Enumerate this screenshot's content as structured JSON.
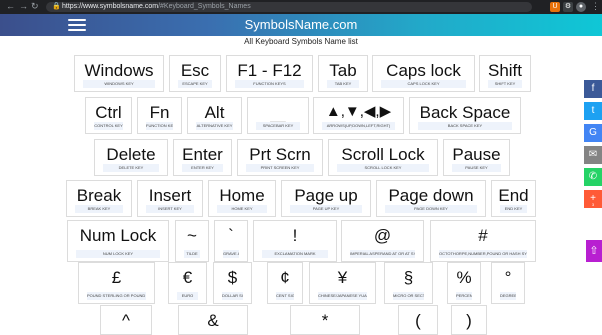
{
  "browser": {
    "url_host": "https://www.symbolsname.com",
    "url_rest": "/#Keyboard_Symbols_Names"
  },
  "site": {
    "title": "SymbolsName.com",
    "subtitle": "All Keyboard Symbols Name list"
  },
  "keys": [
    {
      "sym": "Windows",
      "cap": "WINDOWS KEY"
    },
    {
      "sym": "Esc",
      "cap": "ESCAPE KEY"
    },
    {
      "sym": "F1 - F12",
      "cap": "FUNCTION KEYS"
    },
    {
      "sym": "Tab",
      "cap": "TAB KEY"
    },
    {
      "sym": "Caps lock",
      "cap": "CAPS LOCK KEY"
    },
    {
      "sym": "Shift",
      "cap": "SHIFT KEY"
    },
    {
      "sym": "Ctrl",
      "cap": "CONTROL KEY"
    },
    {
      "sym": "Fn",
      "cap": "FUNCTION KEY"
    },
    {
      "sym": "Alt",
      "cap": "ALTERNATIVE KEY"
    },
    {
      "sym": "▁",
      "cap": "SPACEBAR KEY"
    },
    {
      "sym": "▲,▼,◀,▶",
      "cap": "ARROWS(UP,DOWN,LEFT,RIGHT)"
    },
    {
      "sym": "Back Space",
      "cap": "BACK SPACE KEY"
    },
    {
      "sym": "Delete",
      "cap": "DELETE KEY"
    },
    {
      "sym": "Enter",
      "cap": "ENTER KEY"
    },
    {
      "sym": "Prt Scrn",
      "cap": "PRINT SCREEN KEY"
    },
    {
      "sym": "Scroll Lock",
      "cap": "SCROLL LOCK KEY"
    },
    {
      "sym": "Pause",
      "cap": "PAUSE KEY"
    },
    {
      "sym": "Break",
      "cap": "BREAK KEY"
    },
    {
      "sym": "Insert",
      "cap": "INSERT KEY"
    },
    {
      "sym": "Home",
      "cap": "HOME KEY"
    },
    {
      "sym": "Page up",
      "cap": "PAGE UP KEY"
    },
    {
      "sym": "Page down",
      "cap": "PAGE DOWN KEY"
    },
    {
      "sym": "End",
      "cap": "END KEY"
    },
    {
      "sym": "Num Lock",
      "cap": "NUM LOCK KEY"
    },
    {
      "sym": "~",
      "cap": "TILDE"
    },
    {
      "sym": "`",
      "cap": "GRAVE ACCENT"
    },
    {
      "sym": "!",
      "cap": "EXCLAMATION MARK"
    },
    {
      "sym": "@",
      "cap": "IMPERIAL ASPERAND AT OR AT SYMBOL"
    },
    {
      "sym": "#",
      "cap": "OCTOTHORPE,NUMBER,POUND OR HASH SYMBOL"
    },
    {
      "sym": "£",
      "cap": "POUND STERLING OR POUND SYMBOL"
    },
    {
      "sym": "€",
      "cap": "EURO"
    },
    {
      "sym": "$",
      "cap": "DOLLAR SIGN"
    },
    {
      "sym": "¢",
      "cap": "CENT SIGN"
    },
    {
      "sym": "¥",
      "cap": "CHINESE/JAPANESE YUAN"
    },
    {
      "sym": "§",
      "cap": "MICRO OR SECTION"
    },
    {
      "sym": "%",
      "cap": "PERCENT"
    },
    {
      "sym": "°",
      "cap": "DEGREE"
    },
    {
      "sym": "^",
      "cap": ""
    },
    {
      "sym": "&",
      "cap": ""
    },
    {
      "sym": "*",
      "cap": ""
    },
    {
      "sym": "(",
      "cap": ""
    },
    {
      "sym": ")",
      "cap": ""
    }
  ],
  "share": [
    {
      "icon": "facebook-icon",
      "glyph": "f",
      "color": "#3b5998",
      "count": ""
    },
    {
      "icon": "twitter-icon",
      "glyph": "t",
      "color": "#1da1f2",
      "count": ""
    },
    {
      "icon": "google-icon",
      "glyph": "G",
      "color": "#4285f4",
      "count": ""
    },
    {
      "icon": "email-icon",
      "glyph": "✉",
      "color": "#848484",
      "count": ""
    },
    {
      "icon": "whatsapp-icon",
      "glyph": "✆",
      "color": "#25d366",
      "count": ""
    },
    {
      "icon": "plus-icon",
      "glyph": "+",
      "color": "#ff5a36",
      "count": "3"
    }
  ],
  "scroll_up_glyph": "⇧"
}
